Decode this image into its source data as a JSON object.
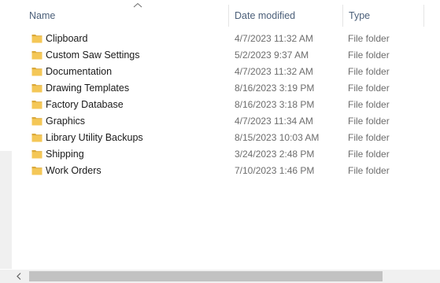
{
  "columns": {
    "name": "Name",
    "date_modified": "Date modified",
    "type": "Type",
    "sorted_by": "Name"
  },
  "icons": {
    "folder": "folder-icon",
    "sort": "chevron-up-icon",
    "scroll_left": "chevron-left-icon"
  },
  "colors": {
    "folder_fill": "#f4c757",
    "folder_dark": "#dba93a",
    "header_text": "#4c607a"
  },
  "files": [
    {
      "name": "Clipboard",
      "date": "4/7/2023 11:32 AM",
      "type": "File folder"
    },
    {
      "name": "Custom Saw Settings",
      "date": "5/2/2023 9:37 AM",
      "type": "File folder"
    },
    {
      "name": "Documentation",
      "date": "4/7/2023 11:32 AM",
      "type": "File folder"
    },
    {
      "name": "Drawing Templates",
      "date": "8/16/2023 3:19 PM",
      "type": "File folder"
    },
    {
      "name": "Factory Database",
      "date": "8/16/2023 3:18 PM",
      "type": "File folder"
    },
    {
      "name": "Graphics",
      "date": "4/7/2023 11:34 AM",
      "type": "File folder"
    },
    {
      "name": "Library Utility Backups",
      "date": "8/15/2023 10:03 AM",
      "type": "File folder"
    },
    {
      "name": "Shipping",
      "date": "3/24/2023 2:48 PM",
      "type": "File folder"
    },
    {
      "name": "Work Orders",
      "date": "7/10/2023 1:46 PM",
      "type": "File folder"
    }
  ]
}
